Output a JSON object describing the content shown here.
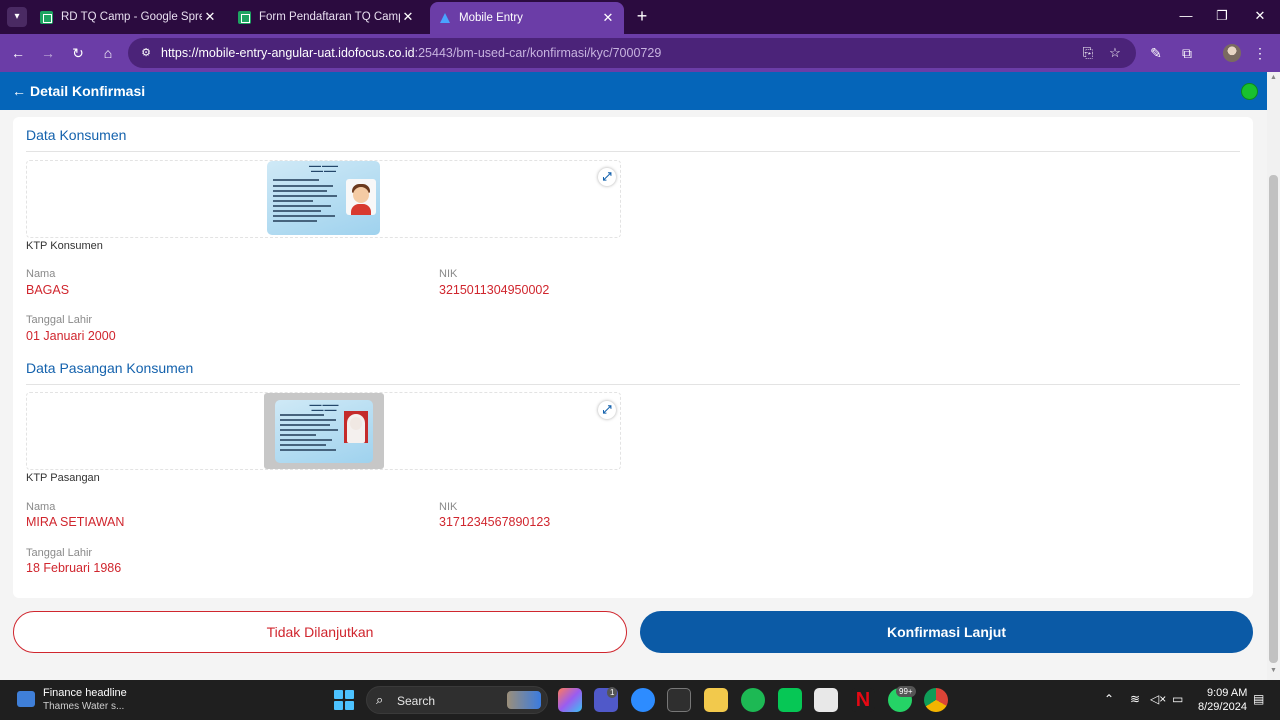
{
  "browser": {
    "tabs": [
      {
        "title": "RD TQ Camp - Google Spreadsheets",
        "favicon": "sheets-icon",
        "active": false
      },
      {
        "title": "Form Pendaftaran TQ Camp Indonesia",
        "favicon": "sheets-icon",
        "active": false
      },
      {
        "title": "Mobile Entry",
        "favicon": "app-icon",
        "active": true
      }
    ],
    "url_host": "https://mobile-entry-angular-uat.idofocus.co.id",
    "url_path": ":25443/bm-used-car/konfirmasi/kyc/7000729"
  },
  "app": {
    "title": "Detail Konfirmasi",
    "status_color": "#19c12e"
  },
  "consumer": {
    "section_title": "Data Konsumen",
    "image_caption": "KTP Konsumen",
    "name_label": "Nama",
    "name": "BAGAS",
    "nik_label": "NIK",
    "nik": "3215011304950002",
    "dob_label": "Tanggal Lahir",
    "dob": "01 Januari 2000"
  },
  "spouse": {
    "section_title": "Data Pasangan Konsumen",
    "image_caption": "KTP Pasangan",
    "name_label": "Nama",
    "name": "MIRA SETIAWAN",
    "nik_label": "NIK",
    "nik": "3171234567890123",
    "dob_label": "Tanggal Lahir",
    "dob": "18 Februari 1986"
  },
  "actions": {
    "reject_label": "Tidak Dilanjutkan",
    "confirm_label": "Konfirmasi Lanjut"
  },
  "taskbar": {
    "news_title": "Finance headline",
    "news_subtitle": "Thames Water s...",
    "search_label": "Search",
    "teams_badge": "1",
    "whatsapp_badge": "99+",
    "time": "9:09 AM",
    "date": "8/29/2024"
  },
  "colors": {
    "primary": "#0565b9",
    "accent_red": "#d0262e",
    "browser_frame": "#6b3da7"
  }
}
